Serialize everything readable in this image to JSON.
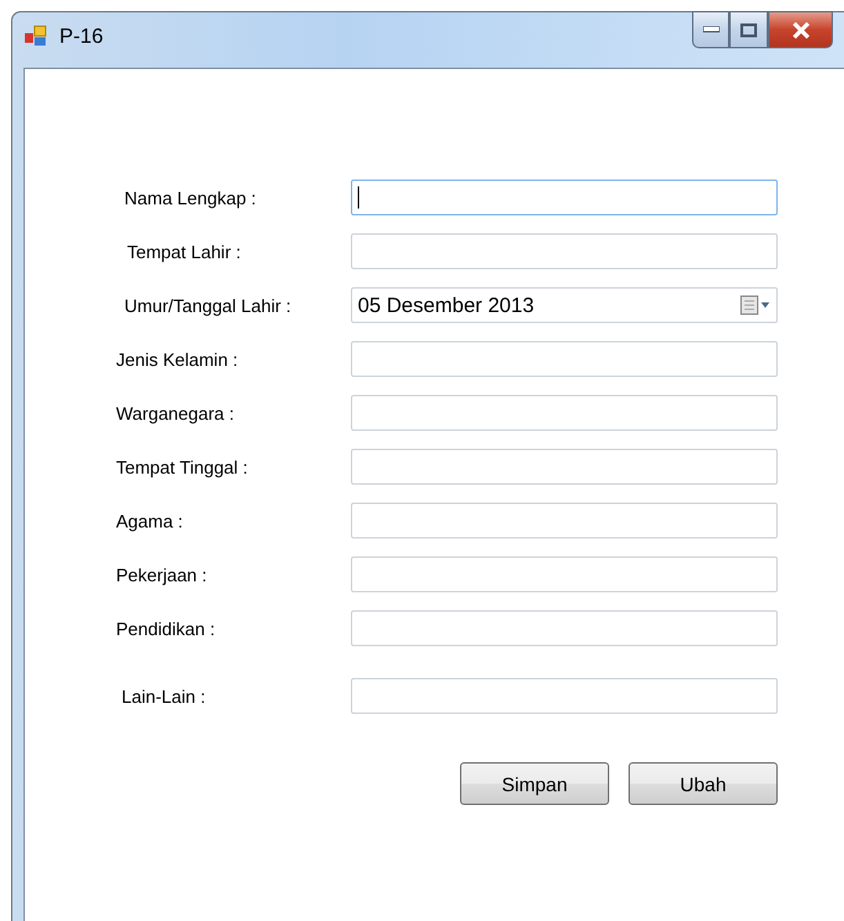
{
  "window": {
    "title": "P-16"
  },
  "fields": [
    {
      "label": "Nama Lengkap :",
      "kind": "text",
      "focused": true
    },
    {
      "label": "Tempat Lahir :",
      "kind": "text",
      "focused": false
    },
    {
      "label": "Umur/Tanggal Lahir :",
      "kind": "date",
      "value": "05 Desember 2013",
      "focused": false
    },
    {
      "label": "Jenis Kelamin :",
      "kind": "text",
      "focused": false
    },
    {
      "label": "Warganegara :",
      "kind": "text",
      "focused": false
    },
    {
      "label": "Tempat Tinggal :",
      "kind": "text",
      "focused": false
    },
    {
      "label": "Agama :",
      "kind": "text",
      "focused": false
    },
    {
      "label": "Pekerjaan :",
      "kind": "text",
      "focused": false
    },
    {
      "label": "Pendidikan :",
      "kind": "text",
      "focused": false
    },
    {
      "label": "Lain-Lain :",
      "kind": "text",
      "focused": false
    }
  ],
  "buttons": [
    "Simpan",
    "Ubah"
  ]
}
